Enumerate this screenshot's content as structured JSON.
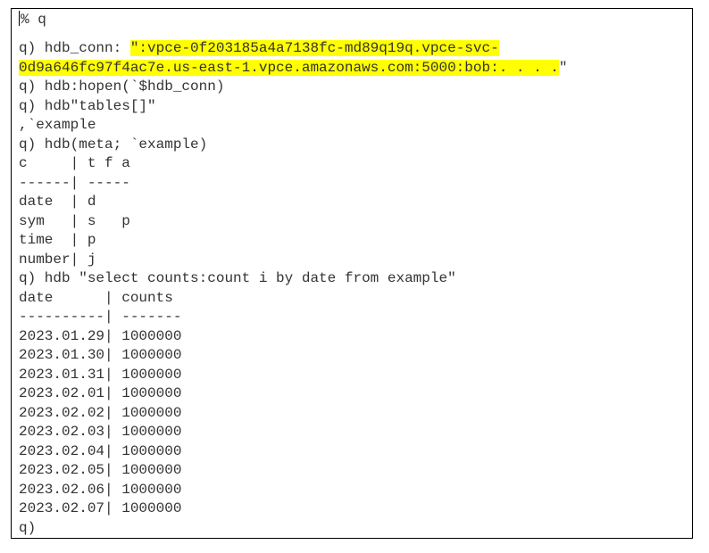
{
  "terminal": {
    "shell_prompt": "% q",
    "highlight_color": "#ffff00",
    "session": {
      "conn_cmd_prefix": "q) hdb_conn: ",
      "conn_string_line1": "\":vpce-0f203185a4a7138fc-md89q19q.vpce-svc-",
      "conn_string_line2": "0d9a646fc97f4ac7e.us-east-1.vpce.amazonaws.com:5000:bob:. . . .",
      "conn_string_end": "\"",
      "hopen_cmd": "q) hdb:hopen(`$hdb_conn)",
      "tables_cmd": "q) hdb\"tables[]\"",
      "tables_result": ",`example",
      "meta_cmd": "q) hdb(meta; `example)",
      "meta_header": "c     | t f a",
      "meta_divider": "------| -----",
      "meta_rows": [
        "date  | d",
        "sym   | s   p",
        "time  | p",
        "number| j"
      ],
      "select_cmd": "q) hdb \"select counts:count i by date from example\"",
      "result_header": "date      | counts",
      "result_divider": "----------| -------",
      "result_rows": [
        "2023.01.29| 1000000",
        "2023.01.30| 1000000",
        "2023.01.31| 1000000",
        "2023.02.01| 1000000",
        "2023.02.02| 1000000",
        "2023.02.03| 1000000",
        "2023.02.04| 1000000",
        "2023.02.05| 1000000",
        "2023.02.06| 1000000",
        "2023.02.07| 1000000"
      ],
      "final_prompt": "q)"
    }
  }
}
